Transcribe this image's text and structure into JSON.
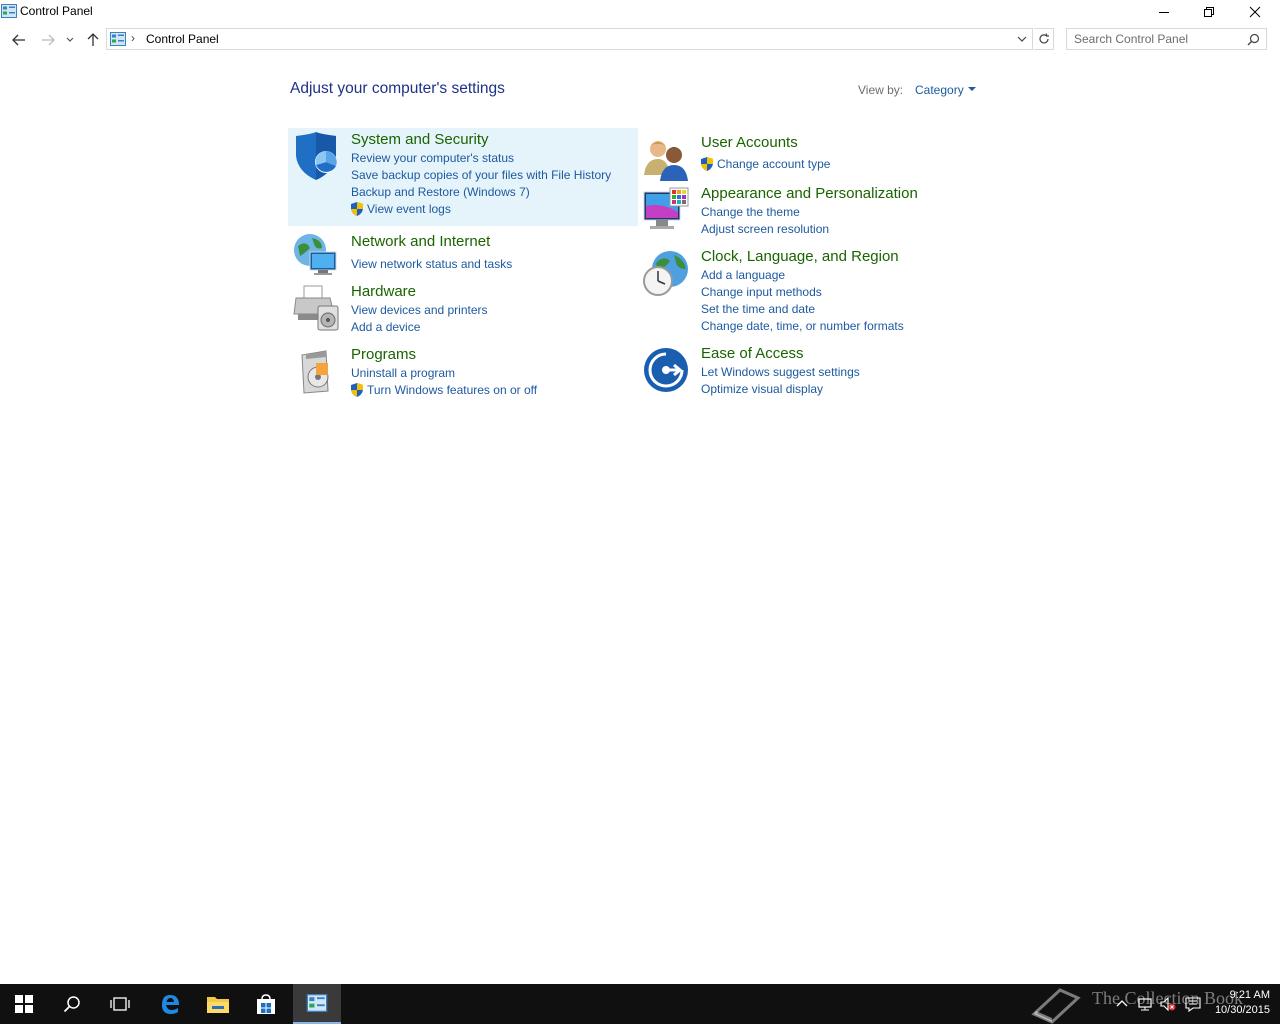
{
  "window": {
    "title": "Control Panel"
  },
  "address": {
    "crumb": "Control Panel",
    "search_placeholder": "Search Control Panel"
  },
  "main": {
    "heading": "Adjust your computer's settings",
    "view_by_label": "View by:",
    "view_by_value": "Category"
  },
  "categories": {
    "system_security": {
      "title": "System and Security",
      "links": [
        "Review your computer's status",
        "Save backup copies of your files with File History",
        "Backup and Restore (Windows 7)",
        "View event logs"
      ]
    },
    "network": {
      "title": "Network and Internet",
      "links": [
        "View network status and tasks"
      ]
    },
    "hardware": {
      "title": "Hardware",
      "links": [
        "View devices and printers",
        "Add a device"
      ]
    },
    "programs": {
      "title": "Programs",
      "links": [
        "Uninstall a program",
        "Turn Windows features on or off"
      ]
    },
    "user_accounts": {
      "title": "User Accounts",
      "links": [
        "Change account type"
      ]
    },
    "appearance": {
      "title": "Appearance and Personalization",
      "links": [
        "Change the theme",
        "Adjust screen resolution"
      ]
    },
    "clock": {
      "title": "Clock, Language, and Region",
      "links": [
        "Add a language",
        "Change input methods",
        "Set the time and date",
        "Change date, time, or number formats"
      ]
    },
    "ease": {
      "title": "Ease of Access",
      "links": [
        "Let Windows suggest settings",
        "Optimize visual display"
      ]
    }
  },
  "taskbar": {
    "time": "9:21 AM",
    "date": "10/30/2015",
    "watermark": "The Collection Book"
  },
  "colors": {
    "category_title": "#196400",
    "link": "#1e5aa0",
    "heading": "#1e3287",
    "highlight": "#e5f3fb",
    "taskbar": "#101010"
  }
}
